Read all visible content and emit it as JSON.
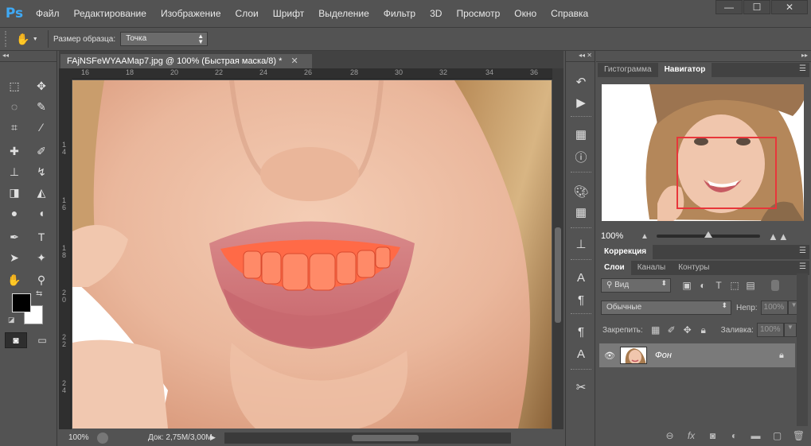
{
  "app": {
    "logo": "Ps",
    "menu": [
      "Файл",
      "Редактирование",
      "Изображение",
      "Слои",
      "Шрифт",
      "Выделение",
      "Фильтр",
      "3D",
      "Просмотр",
      "Окно",
      "Справка"
    ],
    "window_buttons": {
      "minimize": "—",
      "maximize": "☐",
      "close": "✕"
    }
  },
  "options_bar": {
    "tool_icon": "hand-icon",
    "sample_size_label": "Размер образца:",
    "sample_size_value": "Точка"
  },
  "document": {
    "tab_title": "FAjNSFeWYAAMap7.jpg @ 100% (Быстрая маска/8) *",
    "tab_close": "✕",
    "ruler_h": [
      "16",
      "18",
      "20",
      "22",
      "24",
      "26",
      "28",
      "30",
      "32",
      "34",
      "36"
    ],
    "ruler_v": [
      "1\n4",
      "1\n6",
      "1\n8",
      "2\n0",
      "2\n2",
      "2\n4"
    ],
    "zoom": "100%",
    "doc_size": "Док: 2,75M/3,00M"
  },
  "panels": {
    "top_tabs": [
      "Гистограмма",
      "Навигатор"
    ],
    "navigator_zoom": "100%",
    "correction_tab": "Коррекция",
    "layer_tabs": [
      "Слои",
      "Каналы",
      "Контуры"
    ],
    "filter_kind": "Вид",
    "blend_mode": "Обычные",
    "opacity_label": "Непр:",
    "opacity_value": "100%",
    "lock_label": "Закрепить:",
    "fill_label": "Заливка:",
    "fill_value": "100%",
    "layer_name": "Фон"
  },
  "colors": {
    "foreground": "#000000",
    "background": "#ffffff",
    "quickmask_overlay": "#ff5a3c",
    "navigator_frame": "#e8363a"
  }
}
